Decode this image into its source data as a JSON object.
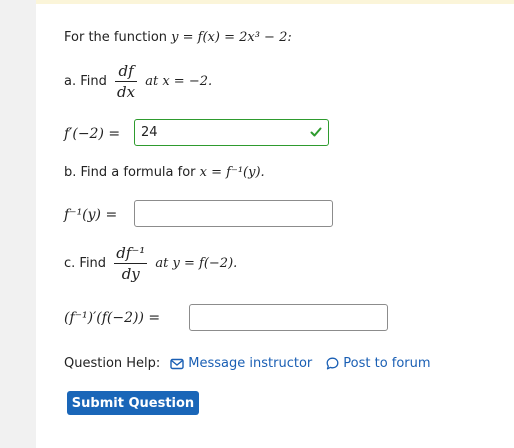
{
  "intro": {
    "text": "For the function ",
    "equation": "y = f(x) = 2x³ − 2:"
  },
  "part_a": {
    "prefix": "a. Find",
    "frac_num": "df",
    "frac_den": "dx",
    "suffix": "at x = −2.",
    "answer_label": "f′(−2) =",
    "answer_value": "24",
    "status": "correct"
  },
  "part_b": {
    "prefix": "b. Find a formula for ",
    "expr": "x = f⁻¹(y).",
    "answer_label": "f⁻¹(y) =",
    "answer_value": ""
  },
  "part_c": {
    "prefix": "c. Find",
    "frac_num": "df⁻¹",
    "frac_den": "dy",
    "suffix": "at y = f(−2).",
    "answer_label": "(f⁻¹)′(f(−2)) =",
    "answer_value": ""
  },
  "help": {
    "label": "Question Help:",
    "message_link": "Message instructor",
    "forum_link": "Post to forum"
  },
  "submit": {
    "label": "Submit Question"
  },
  "colors": {
    "link": "#1a5fb4",
    "button": "#1a66b8",
    "correct": "#2e9b2e"
  }
}
